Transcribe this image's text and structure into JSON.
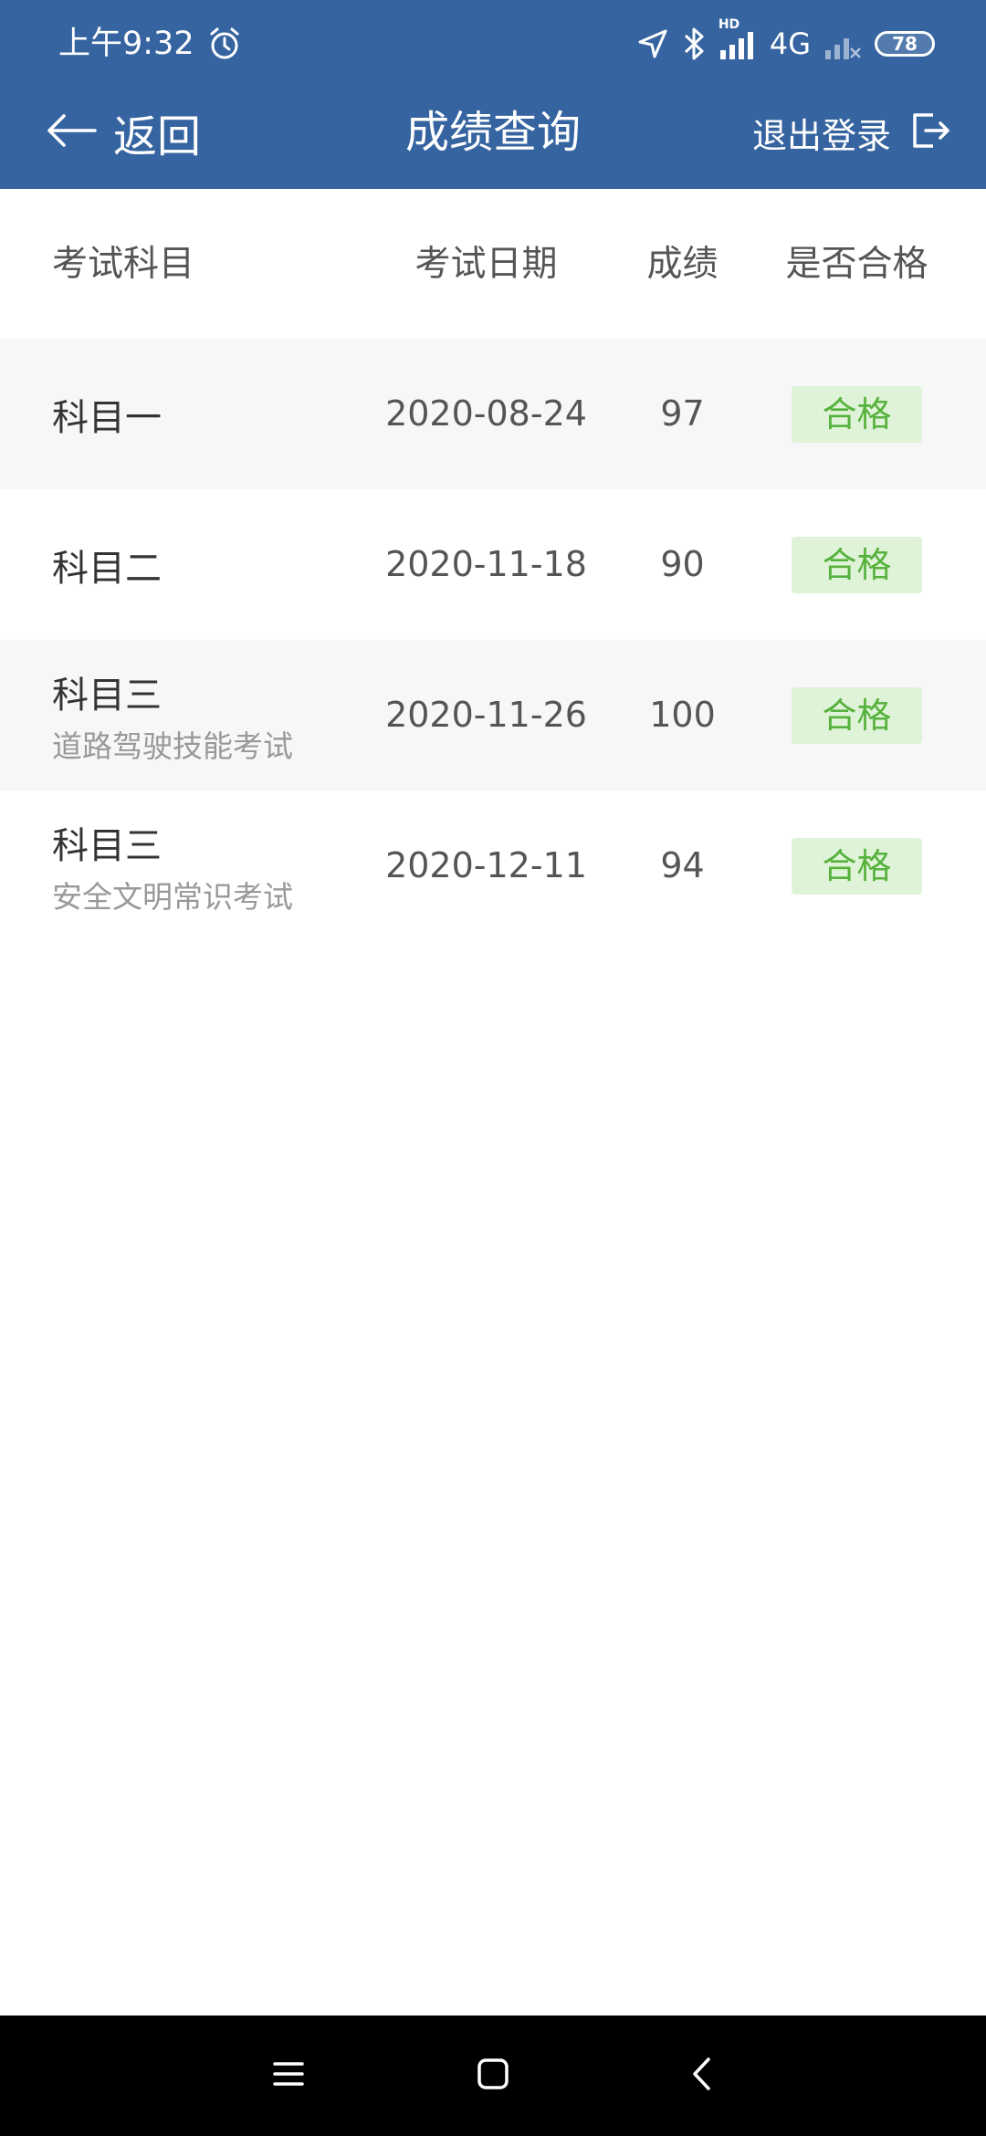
{
  "status_bar": {
    "time": "上午9:32",
    "network": "4G",
    "hd_label": "HD",
    "battery": "78"
  },
  "header": {
    "back_label": "返回",
    "title": "成绩查询",
    "logout_label": "退出登录"
  },
  "table": {
    "columns": [
      "考试科目",
      "考试日期",
      "成绩",
      "是否合格"
    ],
    "rows": [
      {
        "subject": "科目一",
        "subtitle": "",
        "date": "2020-08-24",
        "score": "97",
        "status": "合格"
      },
      {
        "subject": "科目二",
        "subtitle": "",
        "date": "2020-11-18",
        "score": "90",
        "status": "合格"
      },
      {
        "subject": "科目三",
        "subtitle": "道路驾驶技能考试",
        "date": "2020-11-26",
        "score": "100",
        "status": "合格"
      },
      {
        "subject": "科目三",
        "subtitle": "安全文明常识考试",
        "date": "2020-12-11",
        "score": "94",
        "status": "合格"
      }
    ]
  },
  "colors": {
    "header_bg": "#3664a0",
    "pass_badge_bg": "#dff3d8",
    "pass_badge_text": "#57b23d",
    "alt_row_bg": "#f7f7f7"
  },
  "icons": [
    "alarm-icon",
    "location-arrow-icon",
    "bluetooth-icon",
    "signal-icon",
    "battery-icon",
    "back-arrow-icon",
    "logout-icon",
    "menu-icon",
    "home-icon",
    "back-icon"
  ]
}
